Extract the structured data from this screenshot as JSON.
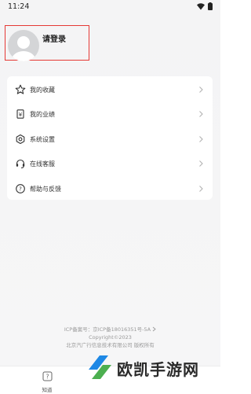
{
  "status_bar": {
    "time": "11:24",
    "icons": [
      "wifi-icon",
      "battery-icon"
    ]
  },
  "profile": {
    "login_prompt": "请登录",
    "avatar_icon": "default-avatar-icon"
  },
  "menu": {
    "items": [
      {
        "label": "我的收藏",
        "icon": "star-icon"
      },
      {
        "label": "我的业绩",
        "icon": "performance-icon"
      },
      {
        "label": "系统设置",
        "icon": "settings-icon"
      },
      {
        "label": "在线客服",
        "icon": "headset-icon"
      },
      {
        "label": "帮助与反馈",
        "icon": "help-icon"
      }
    ]
  },
  "footer": {
    "icp_label": "ICP备案号：",
    "icp_number": "京ICP备18016351号-5A",
    "copyright": "Copyright©2023",
    "company": "北京汽广行信息技术有限公司 版权所有"
  },
  "tabbar": {
    "tabs": [
      {
        "label": "知道",
        "icon": "question-icon"
      }
    ]
  },
  "watermark": {
    "text": "欧凯手游网"
  },
  "colors": {
    "highlight_border": "#e53935",
    "watermark_blue": "#1e88e5",
    "watermark_green": "#4caf50"
  }
}
